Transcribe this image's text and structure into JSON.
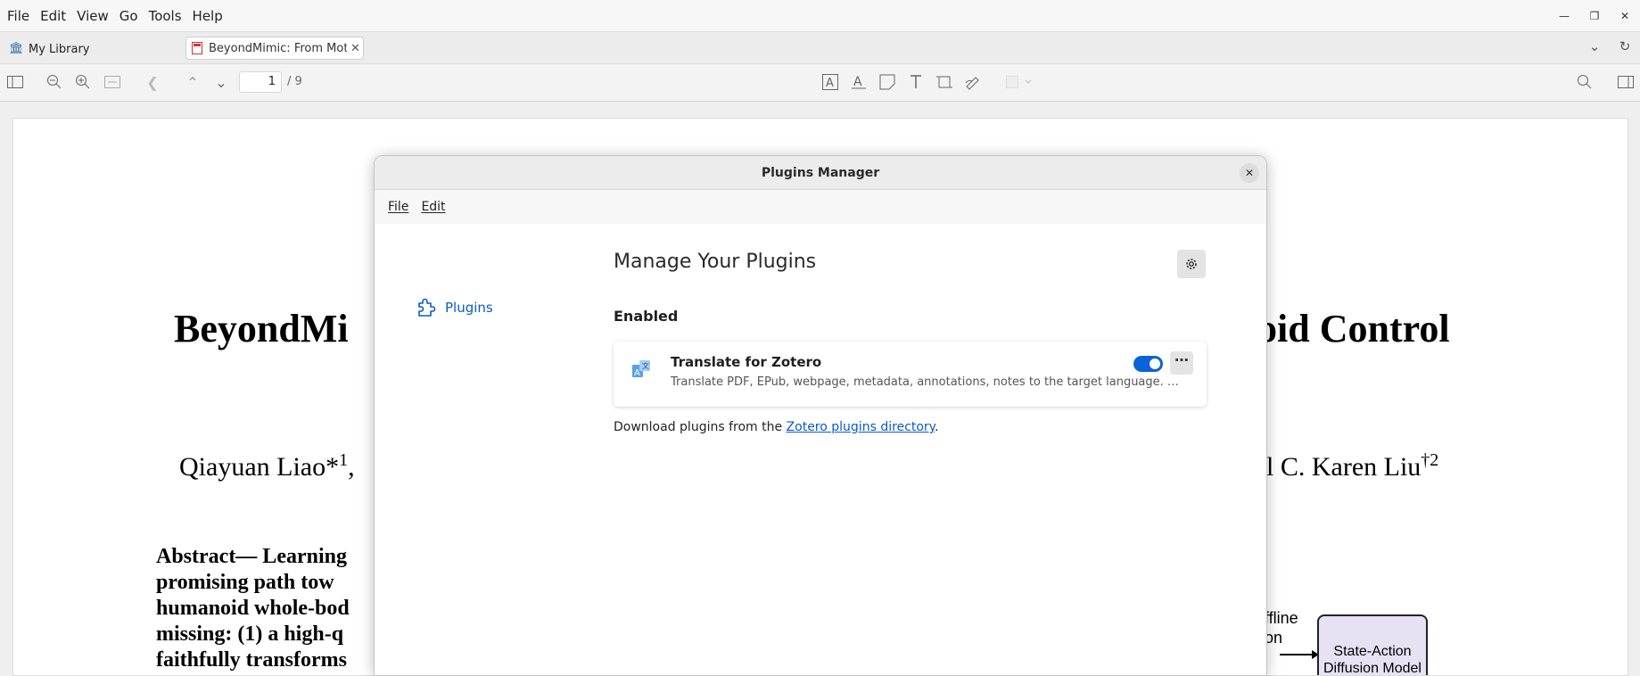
{
  "menubar": {
    "items": [
      "File",
      "Edit",
      "View",
      "Go",
      "Tools",
      "Help"
    ]
  },
  "tabs": {
    "library": "My Library",
    "document": "BeyondMimic: From Motion"
  },
  "toolbar": {
    "page_value": "1",
    "page_total": "/ 9"
  },
  "pdf": {
    "title_left": "BeyondMi",
    "title_right": "oid Control",
    "authors_left": "Qiayuan Liao*",
    "authors_left_sup": "1",
    "authors_left_tail": ",",
    "authors_right": "l C. Karen Liu",
    "authors_right_sup": "†2",
    "abstract_lines": [
      "Abstract— Learning",
      "promising path tow",
      "humanoid whole-bod",
      "missing: (1) a high-q",
      "faithfully transforms"
    ],
    "diagram_label_1": "ffline",
    "diagram_label_2": "on",
    "diagram_box_1": "State-Action",
    "diagram_box_2": "Diffusion Model"
  },
  "dialog": {
    "title": "Plugins Manager",
    "menu": [
      "File",
      "Edit"
    ],
    "sidebar_item": "Plugins",
    "heading": "Manage Your Plugins",
    "enabled_heading": "Enabled",
    "plugin": {
      "name": "Translate for Zotero",
      "description": "Translate PDF, EPub, webpage, metadata, annotations, notes to the target language. Sup…",
      "enabled": true
    },
    "download_prefix": "Download plugins from the ",
    "download_link": "Zotero plugins directory",
    "download_suffix": "."
  },
  "colors": {
    "accent": "#0a63d8",
    "link": "#0a5bc4"
  }
}
